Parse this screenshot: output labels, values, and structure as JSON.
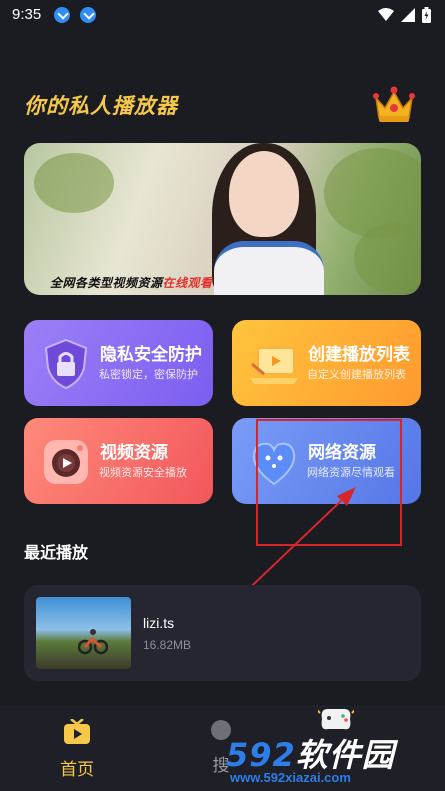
{
  "status_bar": {
    "time": "9:35",
    "icons": [
      "download-icon",
      "download-icon",
      "wifi-icon",
      "signal-icon",
      "battery-icon"
    ]
  },
  "header": {
    "title": "你的私人播放器",
    "title_color": "#f6c84a",
    "vip_icon": "crown-icon"
  },
  "banner": {
    "caption_normal": "全网各类型视频资源",
    "caption_highlight": "在线观看"
  },
  "features": [
    {
      "title": "隐私安全防护",
      "subtitle": "私密锁定，密保防护",
      "icon": "shield-lock-icon",
      "color": "#8a6ef4"
    },
    {
      "title": "创建播放列表",
      "subtitle": "自定义创建播放列表",
      "icon": "laptop-playlist-icon",
      "color": "#ffae35"
    },
    {
      "title": "视频资源",
      "subtitle": "视频资源安全播放",
      "icon": "camera-play-icon",
      "color": "#f86a6a"
    },
    {
      "title": "网络资源",
      "subtitle": "网络资源尽情观看",
      "icon": "heart-network-icon",
      "color": "#6687ee"
    }
  ],
  "recent": {
    "title": "最近播放",
    "items": [
      {
        "name": "lizi.ts",
        "size": "16.82MB"
      }
    ]
  },
  "nav": {
    "home_label": "首页",
    "search_label": "搜",
    "active_color": "#f5c84a"
  },
  "watermark": {
    "brand_digits": "592",
    "brand_text": "软件园",
    "url": "www.592xiazai.com"
  },
  "annotation_color": "#d6262a"
}
